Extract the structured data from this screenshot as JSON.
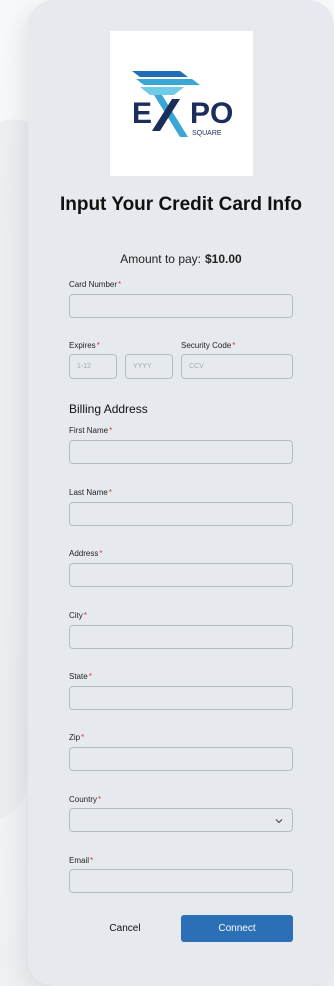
{
  "logo": {
    "main_text": "PO",
    "sub_text": "SQUARE"
  },
  "form": {
    "title": "Input Your Credit Card Info",
    "amount_label": "Amount to pay:",
    "amount_value": "$10.00",
    "card_number_label": "Card Number",
    "expires_label": "Expires",
    "expires_month_placeholder": "1-12",
    "expires_year_placeholder": "YYYY",
    "security_code_label": "Security Code",
    "security_code_placeholder": "CCV",
    "billing_heading": "Billing Address",
    "first_name_label": "First Name",
    "last_name_label": "Last Name",
    "address_label": "Address",
    "city_label": "City",
    "state_label": "State",
    "zip_label": "Zip",
    "country_label": "Country",
    "email_label": "Email",
    "required_mark": "*"
  },
  "buttons": {
    "cancel": "Cancel",
    "connect": "Connect"
  },
  "colors": {
    "accent": "#2b6fb6",
    "required": "#e2323c",
    "card_bg": "#e6e9ee"
  }
}
